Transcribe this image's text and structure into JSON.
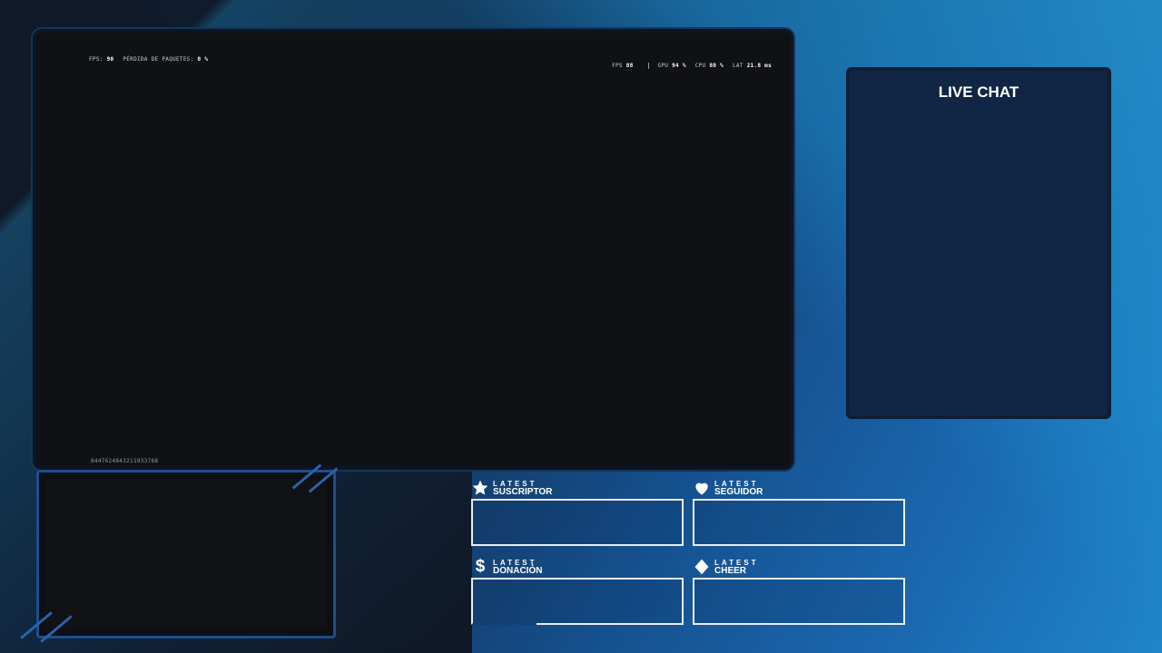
{
  "game_hud": {
    "left_fps_label": "FPS:",
    "left_fps_value": "90",
    "left_loss_label": "PÉRDIDA DE PAQUETES:",
    "left_loss_value": "0 %",
    "right_fps_label": "FPS",
    "right_fps_value": "88",
    "gpu_label": "GPU",
    "gpu_value": "94 %",
    "cpu_label": "CPU",
    "cpu_value": "80 %",
    "lat_label": "LAT",
    "lat_value": "21.8 ms",
    "id_code": "8447624843211933768"
  },
  "chat": {
    "title": "LIVE CHAT"
  },
  "widgets": {
    "subscriber": {
      "top": "LATEST",
      "bottom": "SUSCRIPTOR",
      "icon": "star-icon"
    },
    "follower": {
      "top": "LATEST",
      "bottom": "SEGUIDOR",
      "icon": "heart-icon"
    },
    "donation": {
      "top": "LATEST",
      "bottom": "DONACIÓN",
      "icon": "dollar-icon",
      "symbol": "$"
    },
    "cheer": {
      "top": "LATEST",
      "bottom": "CHEER",
      "icon": "diamond-icon"
    }
  },
  "colors": {
    "accent": "#1d4f8f",
    "frame_dark": "#0f1e36",
    "chat_bg": "#112645",
    "text": "#ffffff"
  }
}
